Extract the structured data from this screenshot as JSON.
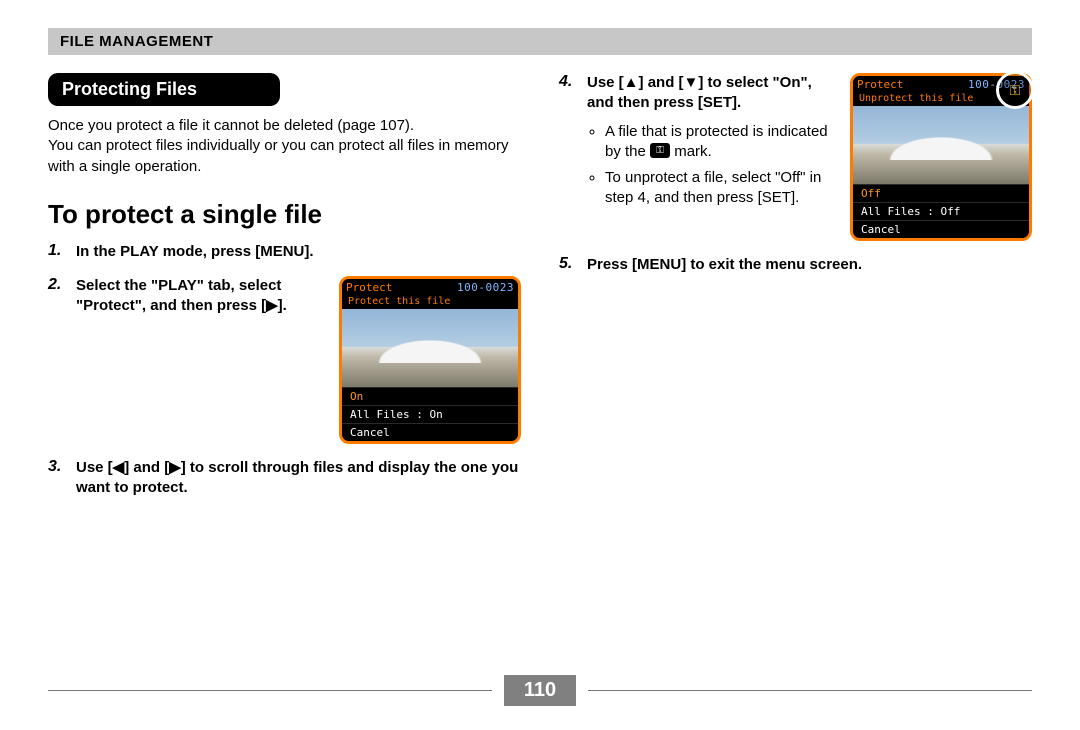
{
  "header": {
    "title": "File Management"
  },
  "section": {
    "title": "Protecting Files"
  },
  "intro": {
    "line1": "Once you protect a file it cannot be deleted (page 107).",
    "line2": "You can protect files individually or you can protect all files in memory with a single operation."
  },
  "subheading": "To protect a single file",
  "steps_left": [
    {
      "num": "1.",
      "text": "In the PLAY mode, press [MENU]."
    },
    {
      "num": "2.",
      "text": "Select the \"PLAY\" tab, select \"Protect\", and then press [▶].",
      "has_image": true
    },
    {
      "num": "3.",
      "text": "Use [◀] and [▶] to scroll through files and display the one you want to protect."
    }
  ],
  "steps_right": [
    {
      "num": "4.",
      "text": "Use [▲] and [▼] to select \"On\", and then press [SET].",
      "has_image": true,
      "notes": [
        {
          "pre": "A file that is protected is indicated by the ",
          "post": " mark.",
          "icon": "key"
        },
        {
          "pre": "To unprotect a file, select \"Off\" in step 4, and then press [SET].",
          "post": ""
        }
      ]
    },
    {
      "num": "5.",
      "text": "Press [MENU] to exit the menu screen."
    }
  ],
  "thumb_a": {
    "title": "Protect",
    "fileno": "100-0023",
    "subtitle": "Protect this file",
    "options": [
      "On",
      "All Files : On",
      "Cancel"
    ],
    "selected_index": 0
  },
  "thumb_b": {
    "title": "Protect",
    "fileno": "100-0023",
    "subtitle": "Unprotect this file",
    "options": [
      "Off",
      "All Files : Off",
      "Cancel"
    ],
    "selected_index": 0,
    "badge": true
  },
  "key_glyph": "⚿",
  "page_number": "110"
}
